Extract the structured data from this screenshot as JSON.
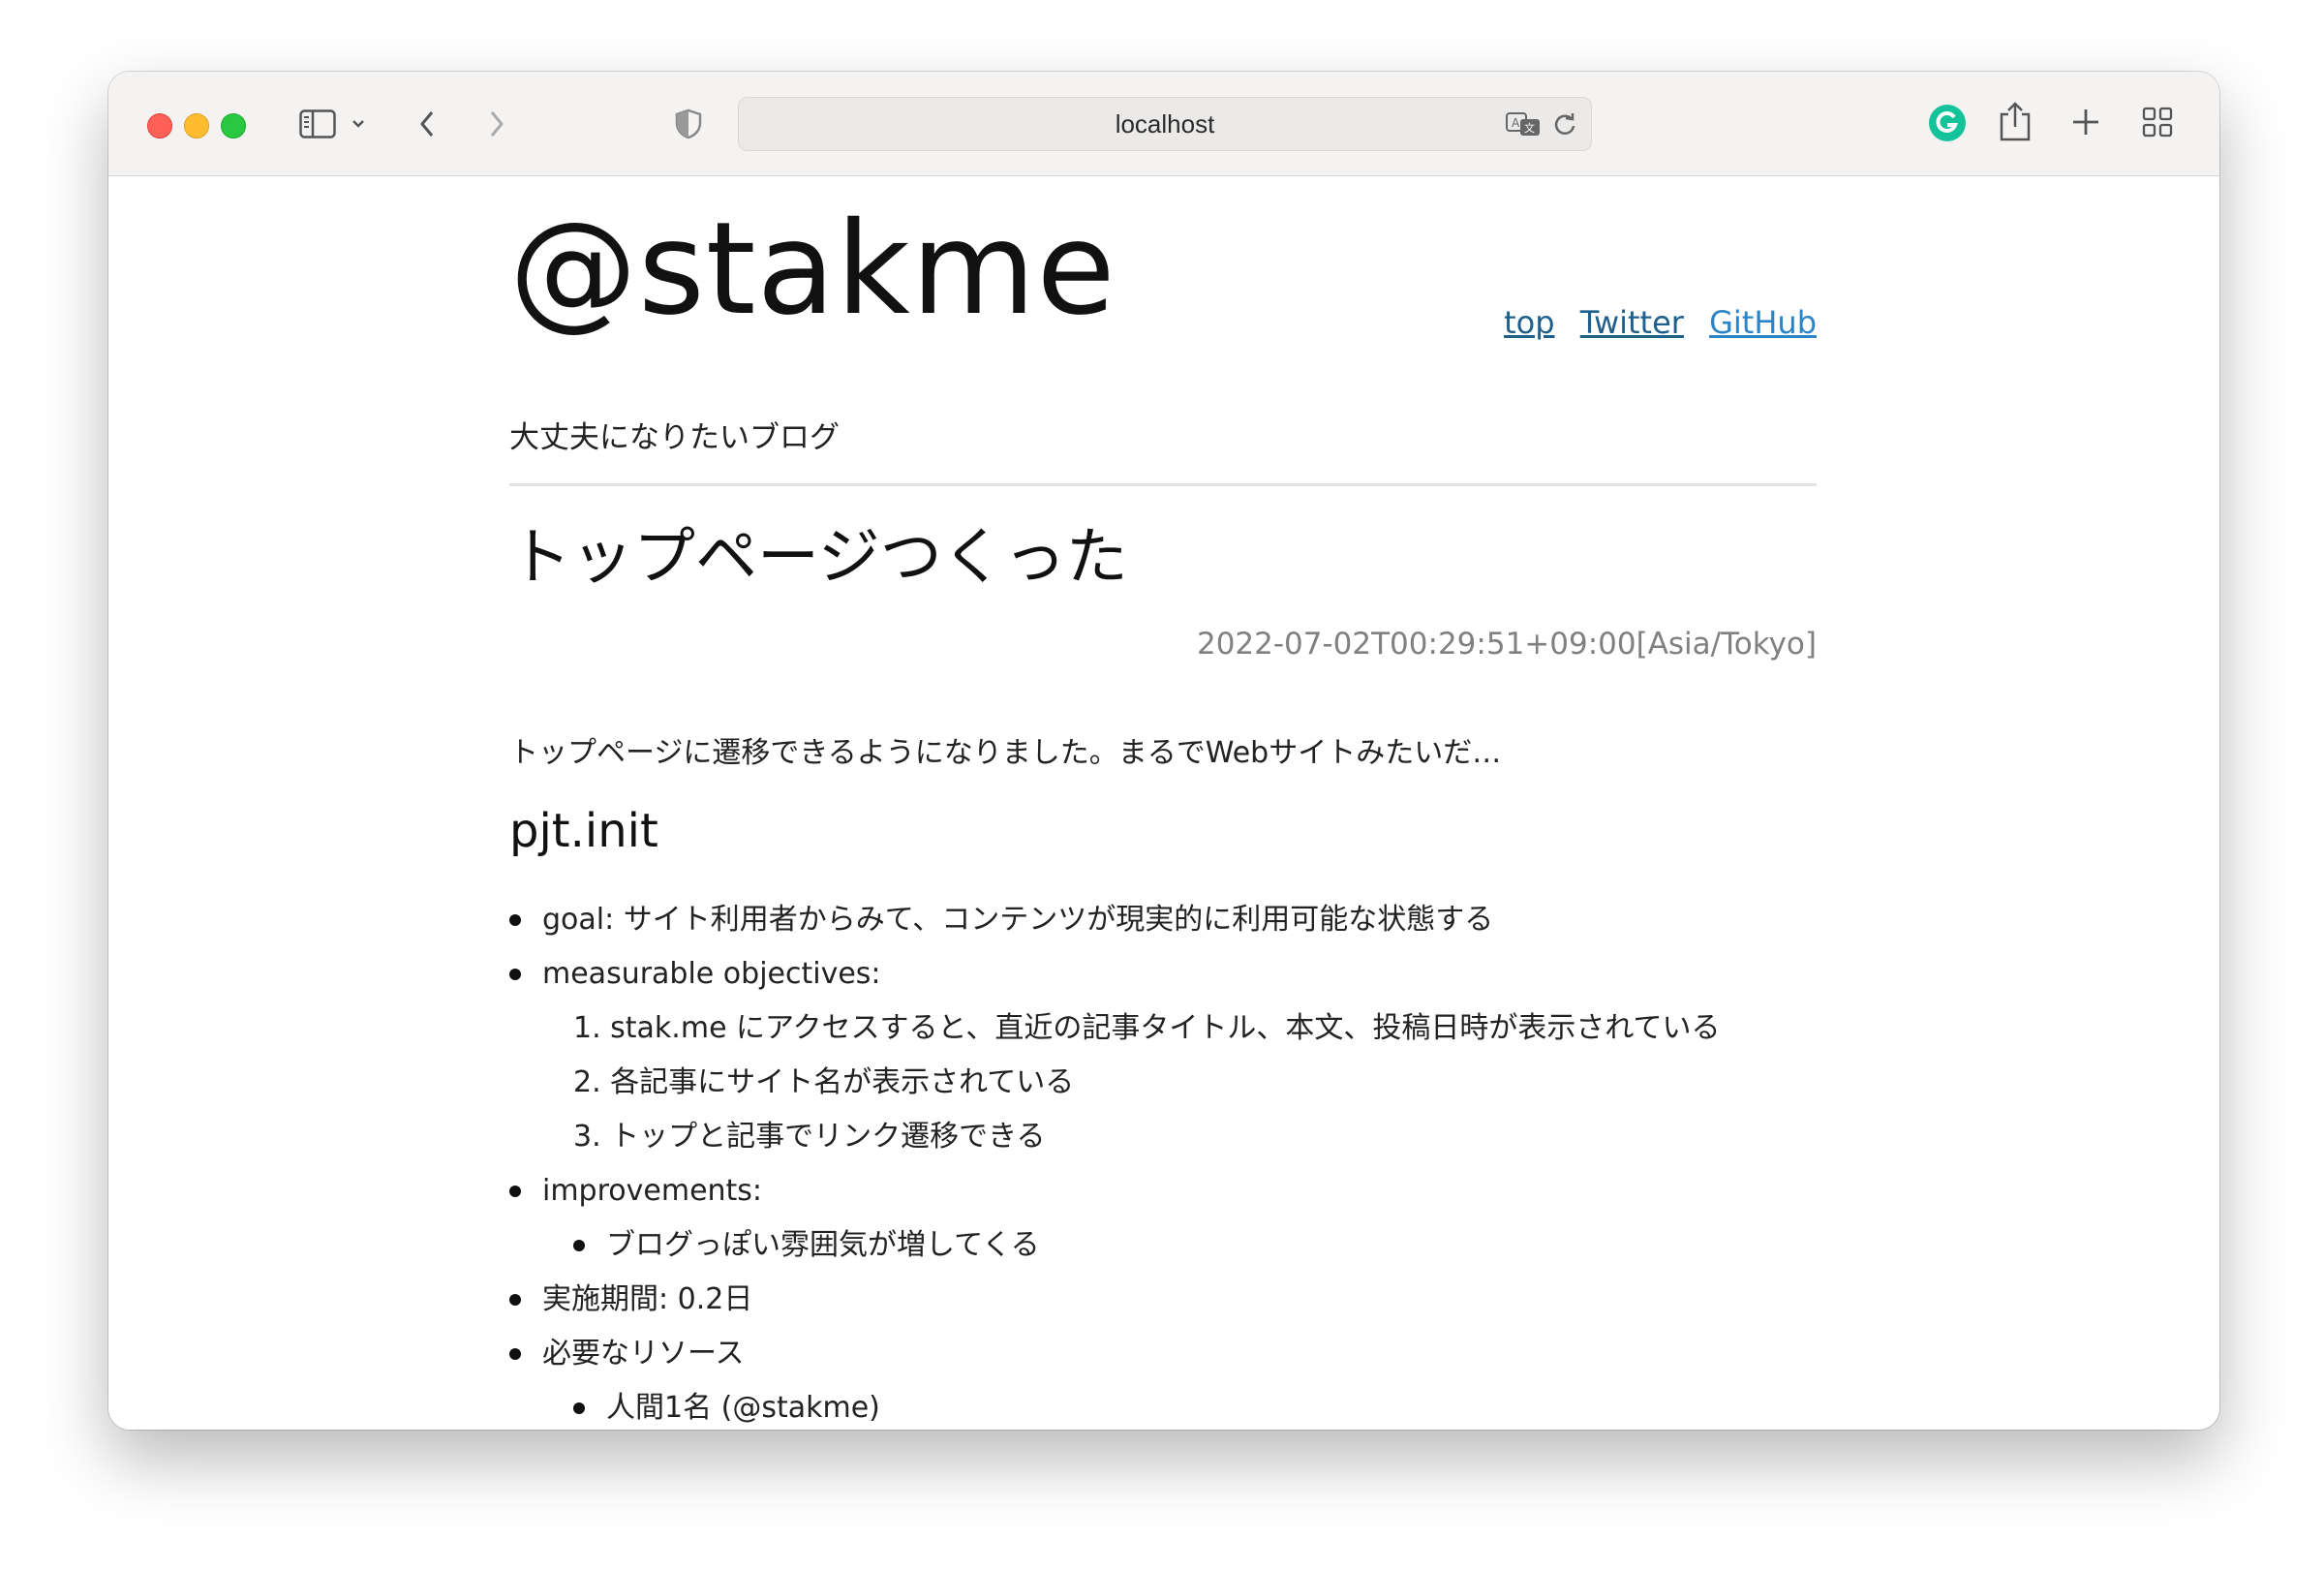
{
  "browser": {
    "address": "localhost"
  },
  "site": {
    "title": "@stakme",
    "tagline": "大丈夫になりたいブログ",
    "nav": [
      "top",
      "Twitter",
      "GitHub"
    ]
  },
  "post": {
    "title": "トップページつくった",
    "date": "2022-07-02T00:29:51+09:00[Asia/Tokyo]",
    "lead": "トップページに遷移できるようになりました。まるでWebサイトみたいだ…",
    "section_heading": "pjt.init",
    "items": {
      "goal": "goal: サイト利用者からみて、コンテンツが現実的に利用可能な状態する",
      "objectives": "measurable objectives:",
      "obj1": "1. stak.me にアクセスすると、直近の記事タイトル、本文、投稿日時が表示されている",
      "obj2": "2. 各記事にサイト名が表示されている",
      "obj3": "3. トップと記事でリンク遷移できる",
      "improvements": "improvements:",
      "imp1": "ブログっぽい雰囲気が増してくる",
      "period": "実施期間: 0.2日",
      "resources": "必要なリソース",
      "res1": "人間1名 (@stakme)"
    }
  },
  "colors": {
    "link": "#1f5f8b",
    "link_alt": "#2b84c6",
    "date": "#808080",
    "grammarly": "#15c39a"
  }
}
